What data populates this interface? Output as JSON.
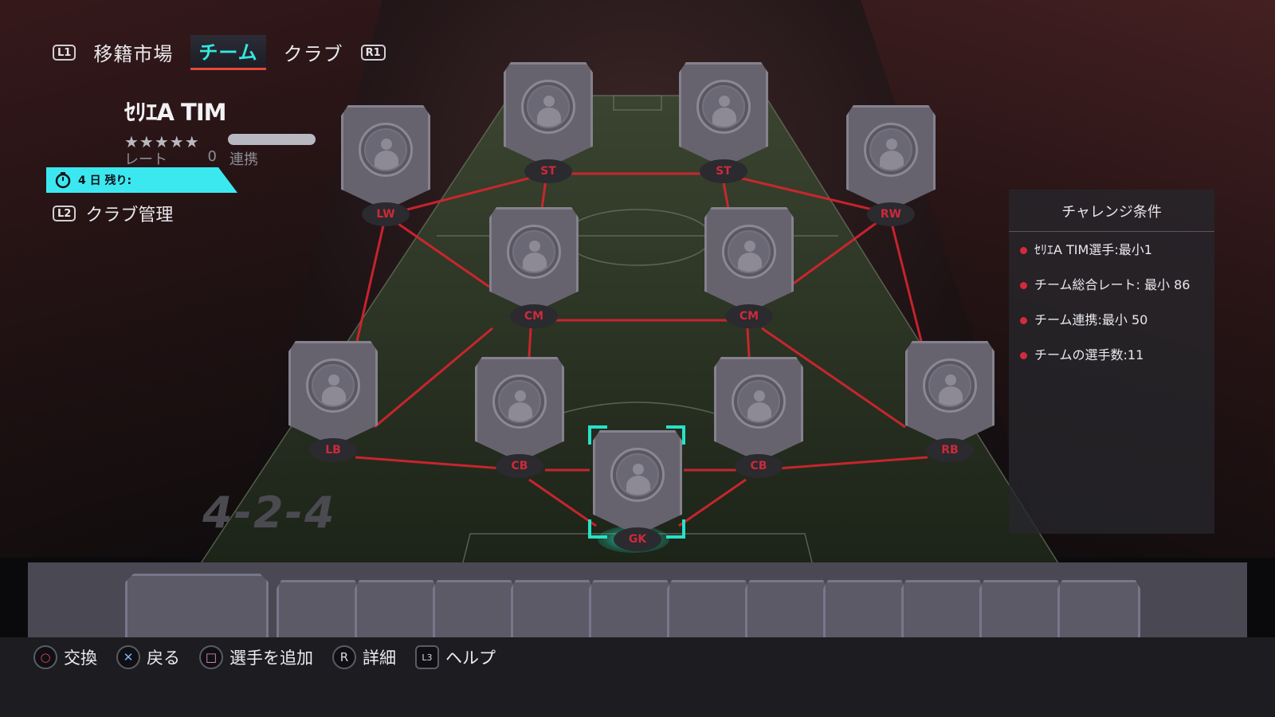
{
  "nav": {
    "l1": "L1",
    "r1": "R1",
    "tabs": [
      "移籍市場",
      "チーム",
      "クラブ"
    ],
    "active_tab": "チーム"
  },
  "squad": {
    "name": "ｾﾘｴA TIM",
    "stars": "★★★★★",
    "rating_label": "レート",
    "rating_value": "0",
    "chemistry_label": "連携",
    "timer_text": "4 日 残り:",
    "club_management": "クラブ管理",
    "l2": "L2"
  },
  "formation": "4-2-4",
  "positions": [
    "ST",
    "ST",
    "LW",
    "RW",
    "CM",
    "CM",
    "LB",
    "CB",
    "CB",
    "RB",
    "GK"
  ],
  "requirements": {
    "title": "チャレンジ条件",
    "items": [
      "ｾﾘｴA TIM選手:最小1",
      "チーム総合レート: 最小 86",
      "チーム連携:最小 50",
      "チームの選手数:11"
    ]
  },
  "hints": [
    {
      "glyph": "○",
      "label": "交換"
    },
    {
      "glyph": "✕",
      "label": "戻る"
    },
    {
      "glyph": "□",
      "label": "選手を追加"
    },
    {
      "glyph": "R",
      "label": "詳細"
    },
    {
      "glyph": "L3",
      "label": "ヘルプ"
    }
  ],
  "colors": {
    "accent": "#34e8e0",
    "link": "#d52a3c",
    "selector": "#27e2c8",
    "card": "#66636f"
  }
}
